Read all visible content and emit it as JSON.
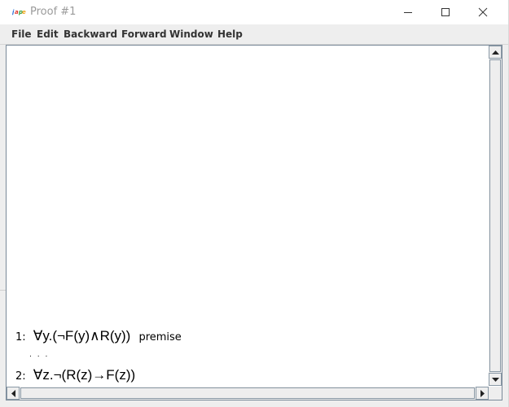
{
  "window": {
    "title": "Proof #1",
    "icon": "jape-app-icon",
    "controls": [
      "minimize-icon",
      "maximize-icon",
      "close-icon"
    ]
  },
  "menubar": {
    "items": [
      "File",
      "Edit",
      "Backward",
      "Forward",
      "Window",
      "Help"
    ]
  },
  "proof": {
    "lines": [
      {
        "number": "1:",
        "formula": "∀y.(¬F(y)∧R(y))",
        "rule": "premise"
      },
      {
        "number": "2:",
        "formula": "∀z.¬(R(z)→F(z))",
        "rule": ""
      }
    ],
    "gap": ". . ."
  },
  "colors": {
    "title_text": "#9a9a9a",
    "menubar_bg": "#eeeeee",
    "frame_border": "#7a8a99"
  }
}
